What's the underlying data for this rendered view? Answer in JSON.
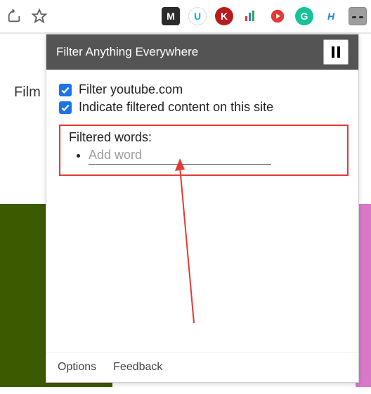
{
  "toolbar": {
    "icons": {
      "share": "share-icon",
      "star": "star-icon"
    },
    "extensions": [
      {
        "name": "ext-m",
        "label": "M"
      },
      {
        "name": "ext-u",
        "label": "U"
      },
      {
        "name": "ext-k",
        "label": "K"
      },
      {
        "name": "ext-bars",
        "label": "⬍"
      },
      {
        "name": "ext-youtube",
        "label": "▶"
      },
      {
        "name": "ext-grammarly",
        "label": "G"
      },
      {
        "name": "ext-honey",
        "label": "H"
      },
      {
        "name": "ext-filter",
        "label": "⌐⌐"
      }
    ]
  },
  "background": {
    "tab_left": "Film"
  },
  "popup": {
    "title": "Filter Anything Everywhere",
    "pause_icon": "pause",
    "options": {
      "filter_site_label": "Filter youtube.com",
      "indicate_label": "Indicate filtered content on this site"
    },
    "filtered_words": {
      "heading": "Filtered words:",
      "add_placeholder": "Add word"
    },
    "footer": {
      "options": "Options",
      "feedback": "Feedback"
    }
  },
  "annotation": {
    "arrow": "red-arrow"
  }
}
